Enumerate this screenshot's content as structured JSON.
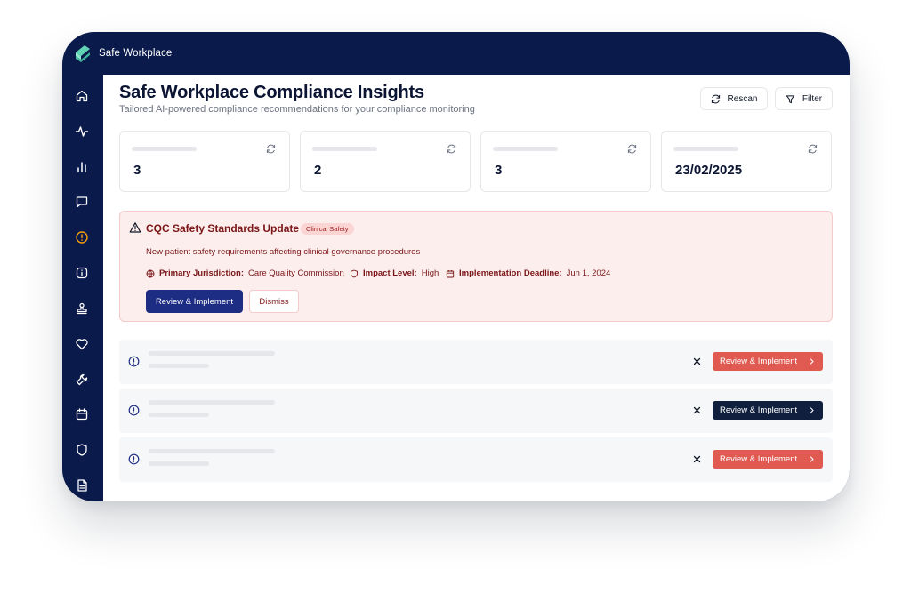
{
  "app": {
    "brand": "Safe Workplace",
    "colors": {
      "navy": "#0a1a4a",
      "primary": "#1e2d84",
      "danger": "#e05a52",
      "dark": "#0f1f3d",
      "alert_bg": "#fdeeee",
      "alert_text": "#7a1616"
    }
  },
  "sidebar": {
    "items": [
      {
        "icon": "home-icon"
      },
      {
        "icon": "activity-icon"
      },
      {
        "icon": "bar-chart-icon"
      },
      {
        "icon": "message-icon"
      },
      {
        "icon": "alert-circle-icon",
        "active": true
      },
      {
        "icon": "info-icon"
      },
      {
        "icon": "stamp-icon"
      },
      {
        "icon": "heart-icon"
      },
      {
        "icon": "wrench-icon"
      },
      {
        "icon": "calendar-icon"
      },
      {
        "icon": "shield-icon"
      },
      {
        "icon": "file-icon"
      }
    ]
  },
  "header": {
    "title": "Safe Workplace Compliance Insights",
    "subtitle": "Tailored AI-powered compliance recommendations for your compliance monitoring",
    "rescan_label": "Rescan",
    "filter_label": "Filter"
  },
  "stats": [
    {
      "value": "3"
    },
    {
      "value": "2"
    },
    {
      "value": "3"
    },
    {
      "value": "23/02/2025"
    }
  ],
  "alert": {
    "title": "CQC Safety Standards Update",
    "tag": "Clinical Safety",
    "description": "New patient safety requirements affecting clinical governance procedures",
    "jurisdiction_label": "Primary Jurisdiction:",
    "jurisdiction_value": "Care Quality Commission",
    "impact_label": "Impact Level:",
    "impact_value": "High",
    "deadline_label": "Implementation Deadline:",
    "deadline_value": "Jun 1, 2024",
    "primary_action": "Review & Implement",
    "dismiss_action": "Dismiss"
  },
  "rows": [
    {
      "action": "Review & Implement",
      "style": "danger"
    },
    {
      "action": "Review & Implement",
      "style": "dark"
    },
    {
      "action": "Review & Implement",
      "style": "danger"
    }
  ]
}
